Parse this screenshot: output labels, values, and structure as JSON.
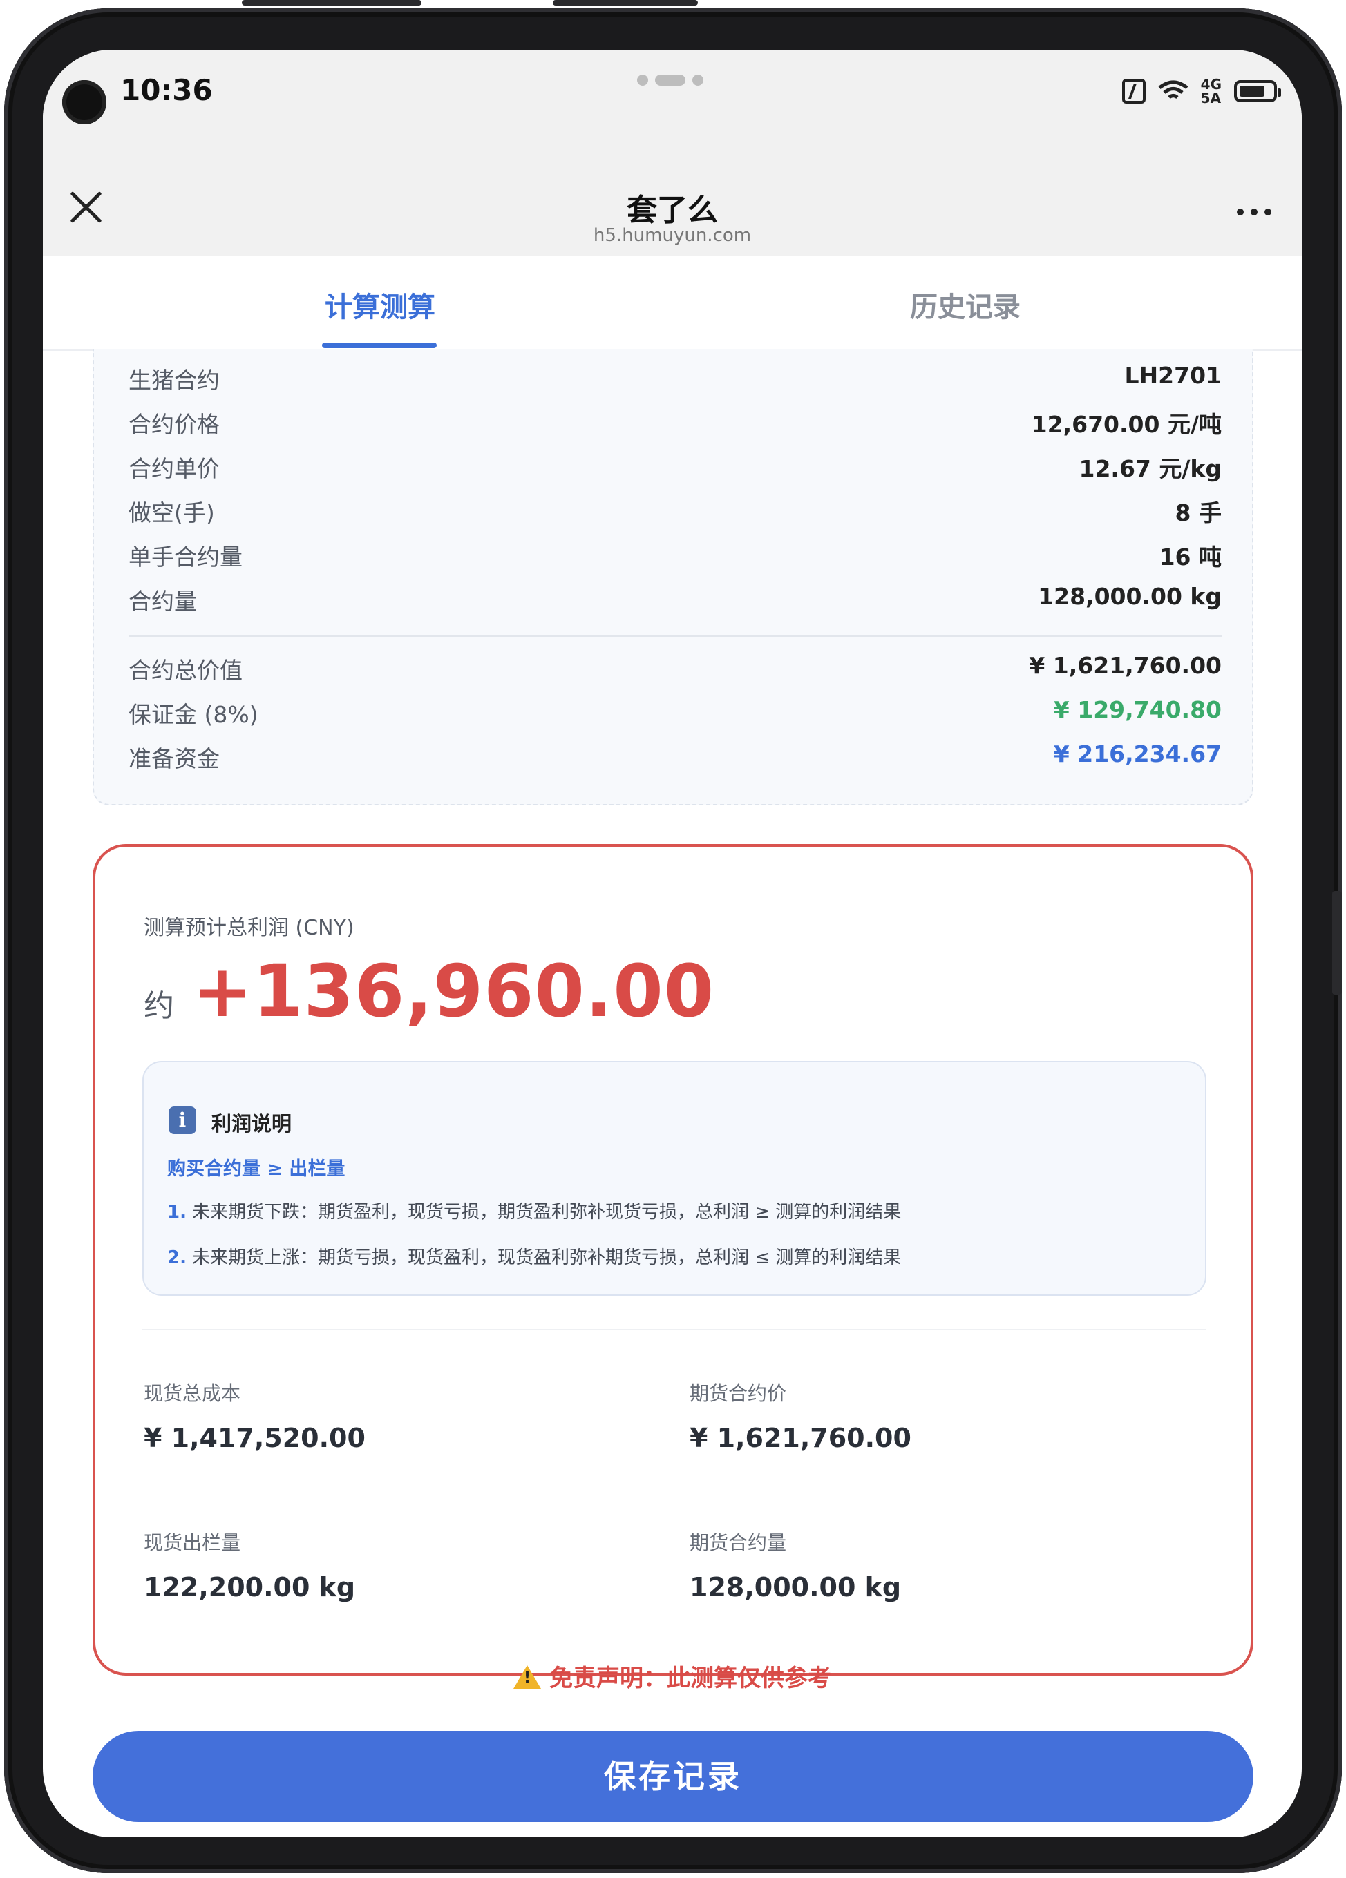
{
  "status_bar": {
    "time": "10:36",
    "network_top": "4G",
    "network_bottom": "5A"
  },
  "nav": {
    "title": "套了么",
    "url": "h5.humuyun.com"
  },
  "tabs": [
    {
      "label": "计算测算",
      "active": true
    },
    {
      "label": "历史记录",
      "active": false
    }
  ],
  "contract": {
    "rows": [
      {
        "label": "生猪合约",
        "value": "LH2701"
      },
      {
        "label": "合约价格",
        "value": "12,670.00 元/吨"
      },
      {
        "label": "合约单价",
        "value": "12.67 元/kg"
      },
      {
        "label": "做空(手)",
        "value": "8 手"
      },
      {
        "label": "单手合约量",
        "value": "16 吨"
      },
      {
        "label": "合约量",
        "value": "128,000.00 kg"
      }
    ],
    "totals": [
      {
        "label": "合约总价值",
        "value": "¥ 1,621,760.00"
      },
      {
        "label": "保证金 (8%)",
        "value": "¥ 129,740.80"
      },
      {
        "label": "准备资金",
        "value": "¥ 216,234.67"
      }
    ]
  },
  "profit": {
    "label": "测算预计总利润 (CNY)",
    "prefix": "约",
    "value": "+136,960.00",
    "note": {
      "title": "利润说明",
      "condition": "购买合约量 ≥ 出栏量",
      "lines": [
        {
          "num": "1.",
          "text": "未来期货下跌：期货盈利，现货亏损，期货盈利弥补现货亏损，总利润 ≥ 测算的利润结果"
        },
        {
          "num": "2.",
          "text": "未来期货上涨：期货亏损，现货盈利，现货盈利弥补期货亏损，总利润 ≤ 测算的利润结果"
        }
      ]
    },
    "stats": [
      {
        "label": "现货总成本",
        "value": "¥ 1,417,520.00"
      },
      {
        "label": "期货合约价",
        "value": "¥ 1,621,760.00"
      },
      {
        "label": "现货出栏量",
        "value": "122,200.00 kg"
      },
      {
        "label": "期货合约量",
        "value": "128,000.00 kg"
      }
    ]
  },
  "disclaimer": "免责声明：此测算仅供参考",
  "save_button": "保存记录",
  "colors": {
    "accent": "#3b6fd8",
    "profit_red": "#d94b47",
    "margin_green": "#3aaa6a",
    "button_blue": "#4470da"
  }
}
